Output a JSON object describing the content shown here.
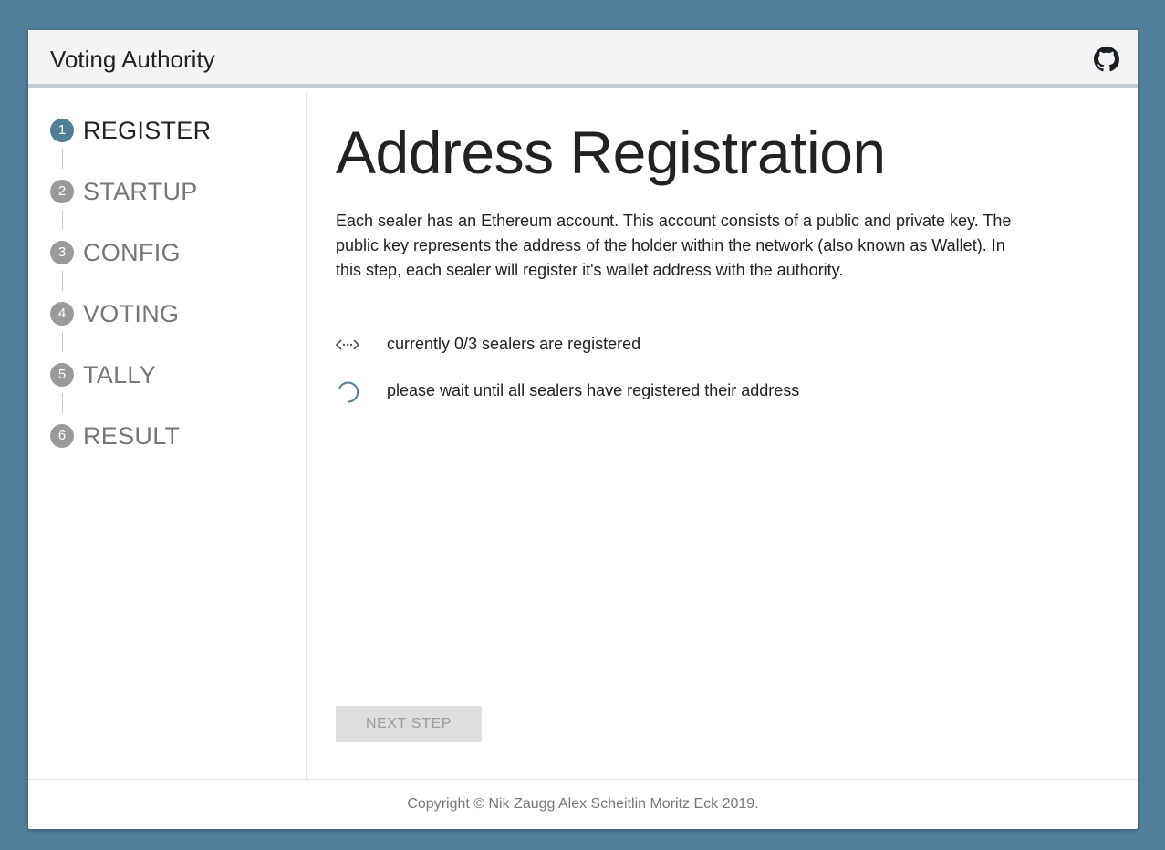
{
  "app": {
    "title": "Voting Authority",
    "github_icon": "github-icon"
  },
  "sidebar": {
    "steps": [
      {
        "number": "1",
        "label": "REGISTER",
        "active": true
      },
      {
        "number": "2",
        "label": "STARTUP",
        "active": false
      },
      {
        "number": "3",
        "label": "CONFIG",
        "active": false
      },
      {
        "number": "4",
        "label": "VOTING",
        "active": false
      },
      {
        "number": "5",
        "label": "TALLY",
        "active": false
      },
      {
        "number": "6",
        "label": "RESULT",
        "active": false
      }
    ]
  },
  "main": {
    "heading": "Address Registration",
    "description": "Each sealer has an Ethereum account. This account consists of a public and private key. The public key represents the address of the holder within the network (also known as Wallet). In this step, each sealer will register it's wallet address with the authority.",
    "status": [
      {
        "icon": "code-brackets-icon",
        "text": "currently 0/3 sealers are registered"
      },
      {
        "icon": "loading-spinner-icon",
        "text": "please wait until all sealers have registered their address"
      }
    ],
    "next_button": "NEXT STEP"
  },
  "footer": {
    "copyright": "Copyright © Nik Zaugg Alex Scheitlin Moritz Eck 2019."
  },
  "colors": {
    "background": "#517e98",
    "accent": "#517e98",
    "inactive_step": "#9a9a9a",
    "header_bg": "#f4f4f4"
  }
}
